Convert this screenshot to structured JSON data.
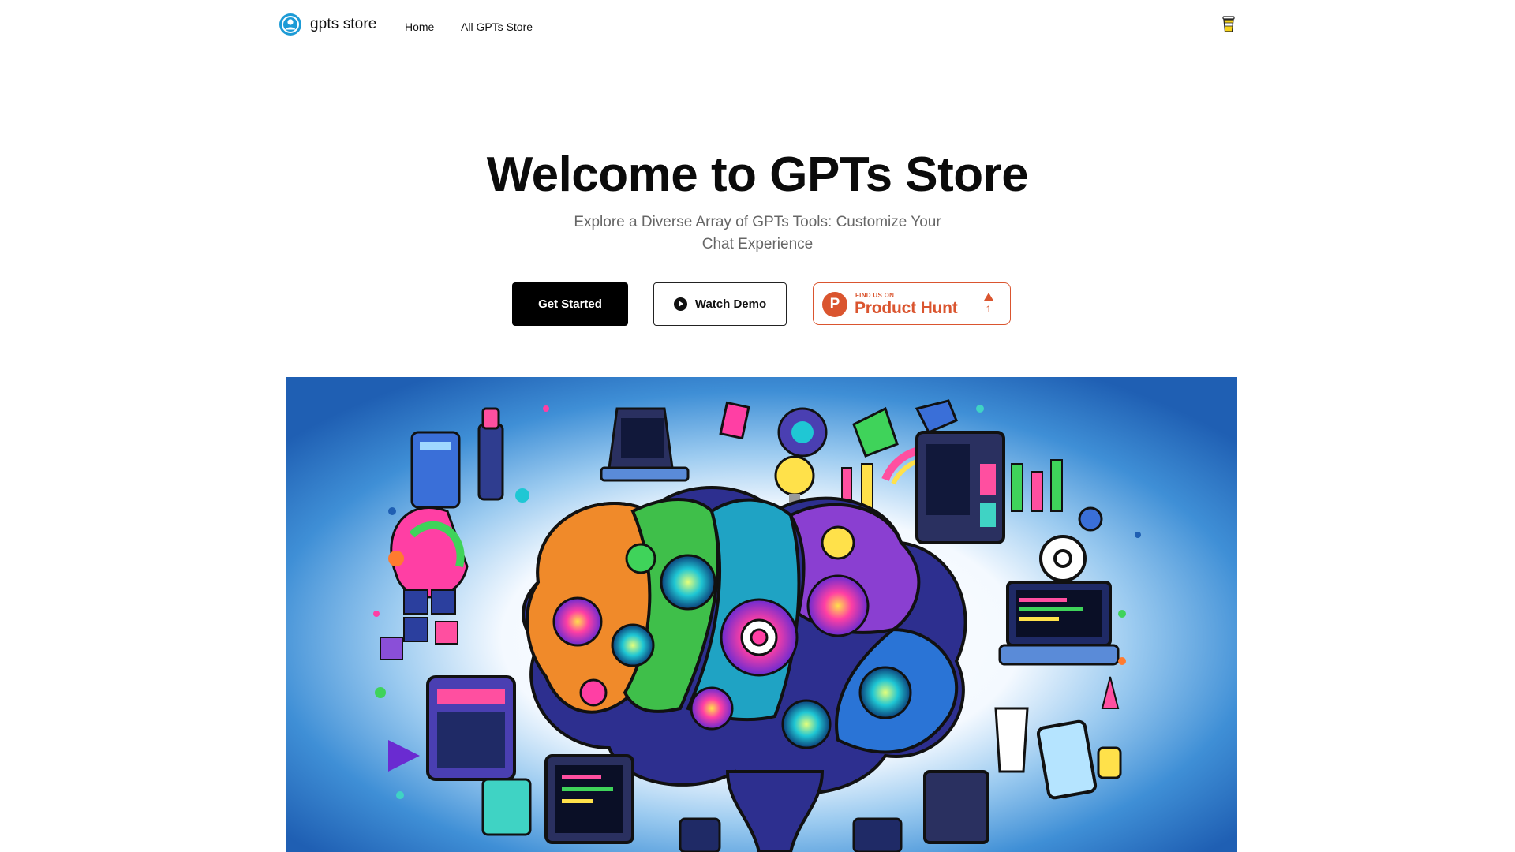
{
  "header": {
    "brand": "gpts store",
    "nav": [
      {
        "label": "Home"
      },
      {
        "label": "All GPTs Store"
      }
    ],
    "icons": {
      "logo": "person-circle-icon",
      "coffee": "coffee-cup-icon"
    }
  },
  "hero": {
    "title": "Welcome to GPTs Store",
    "subtitle": "Explore a Diverse Array of GPTs Tools: Customize Your Chat Experience",
    "buttons": {
      "get_started": "Get Started",
      "watch_demo": "Watch Demo"
    },
    "product_hunt": {
      "small_label": "FIND US ON",
      "big_label": "Product Hunt",
      "logo_letter": "P",
      "upvotes": "1"
    }
  },
  "colors": {
    "primary": "#000000",
    "product_hunt": "#da552f",
    "subtitle": "#666666",
    "image_background": "#1e74c6"
  }
}
